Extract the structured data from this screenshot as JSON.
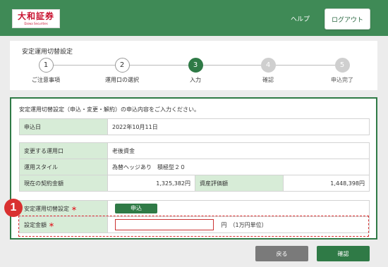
{
  "header": {
    "logo_main": "大和証券",
    "logo_sub": "Daiwa Securities",
    "help_label": "ヘルプ",
    "logout_label": "ログアウト",
    "bg_color": "#3f8a56"
  },
  "steps": {
    "title": "安定運用切替設定",
    "items": [
      {
        "number": "1",
        "label": "ご注意事項",
        "state": "done"
      },
      {
        "number": "2",
        "label": "運用口の選択",
        "state": "done"
      },
      {
        "number": "3",
        "label": "入力",
        "state": "active"
      },
      {
        "number": "4",
        "label": "確認",
        "state": "future"
      },
      {
        "number": "5",
        "label": "申込完了",
        "state": "future"
      }
    ]
  },
  "form": {
    "intro": "安定運用切替設定（申込・変更・解約）の申込内容をご入力ください。",
    "apply_date_label": "申込日",
    "apply_date_value": "2022年10月11日",
    "account_label": "変更する運用口",
    "account_value": "老後資金",
    "style_label": "運用スタイル",
    "style_value": "為替ヘッジあり　積極型２０",
    "contract_label": "現在の契約金額",
    "contract_value": "1,325,382円",
    "asset_label": "資産評価額",
    "asset_value": "1,448,398円",
    "switch_label": "安定運用切替設定",
    "switch_button": "申込",
    "amount_label": "設定金額",
    "amount_value": "",
    "amount_unit": "円　（1万円単位）",
    "required_mark": "＊"
  },
  "annotation": {
    "marker": "1",
    "color": "#d93030"
  },
  "footer": {
    "back_label": "戻る",
    "confirm_label": "確認",
    "accent_color": "#2f7a46"
  }
}
